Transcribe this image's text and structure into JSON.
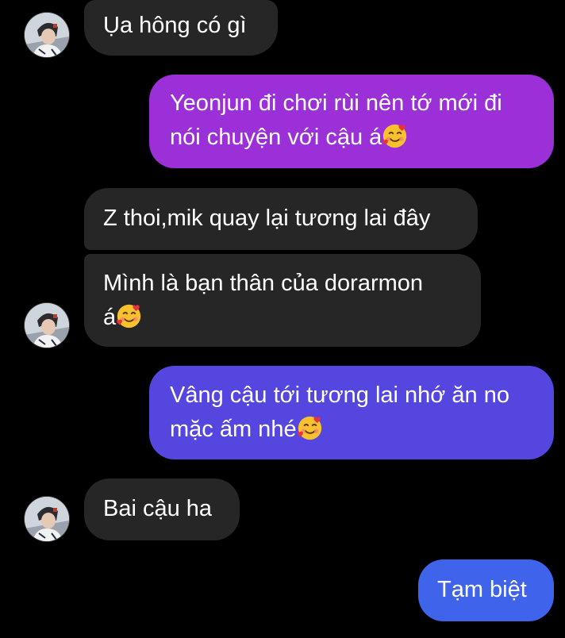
{
  "colors": {
    "background": "#000000",
    "incoming_bubble": "#262626",
    "outgoing_bubble_1": "#9b2fd8",
    "outgoing_bubble_2": "#5546e0",
    "outgoing_bubble_3": "#3f63ea",
    "text": "#ffffff"
  },
  "messages": [
    {
      "direction": "incoming",
      "text": "Ụa hông có gì",
      "has_avatar": true
    },
    {
      "direction": "outgoing",
      "line1": "Yeonjun đi chơi rùi nên tớ mới đi",
      "line2": "nói chuyện với cậu á",
      "emoji": "smiling-face-with-hearts-icon"
    },
    {
      "direction": "incoming",
      "text": "Z thoi,mik quay lại tương lai đây",
      "has_avatar": false
    },
    {
      "direction": "incoming",
      "line1": "Mình là bạn thân của dorarmon",
      "line2": "á",
      "emoji": "smiling-face-with-hearts-icon",
      "has_avatar": true
    },
    {
      "direction": "outgoing",
      "line1": "Vâng cậu tới tương lai nhớ ăn no",
      "line2": "mặc ấm nhé",
      "emoji": "smiling-face-with-hearts-icon"
    },
    {
      "direction": "incoming",
      "text": "Bai cậu ha",
      "has_avatar": true
    },
    {
      "direction": "outgoing",
      "text": "Tạm biệt"
    }
  ]
}
